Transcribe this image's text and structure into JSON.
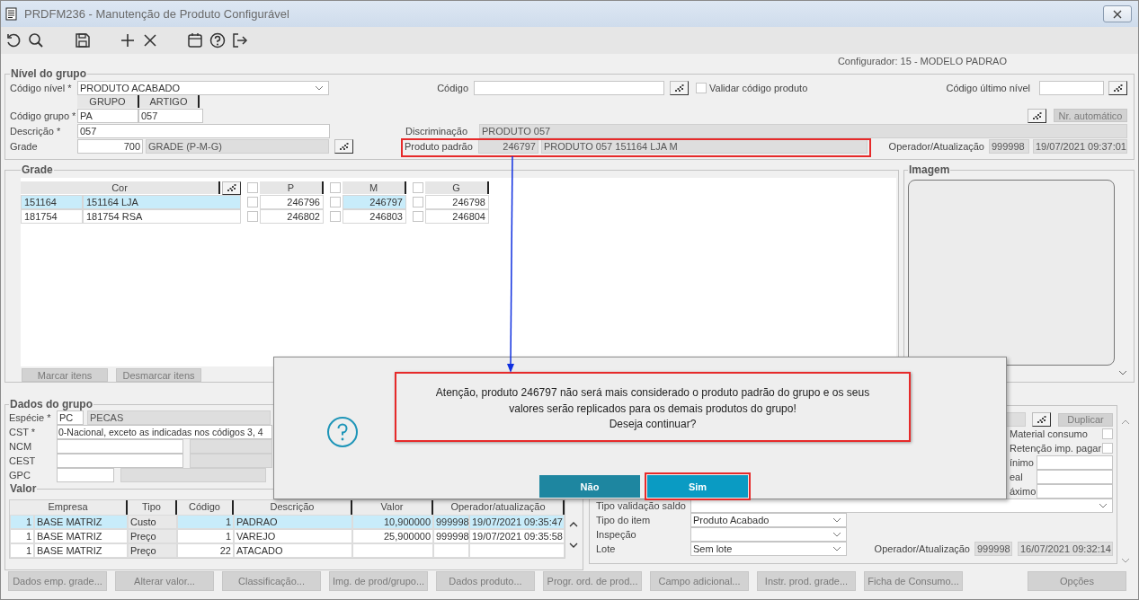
{
  "window": {
    "title": "PRDFM236 - Manutenção de Produto Configurável"
  },
  "configurador": "Configurador: 15 - MODELO PADRAO",
  "nivel_do_grupo": {
    "legend": "Nível do grupo",
    "codigo_nivel": {
      "label": "Código nível *",
      "value": "PRODUTO ACABADO"
    },
    "codigo": {
      "label": "Código"
    },
    "validar": {
      "label": "Validar código produto",
      "checked": false
    },
    "codigo_ultimo_nivel": {
      "label": "Código último nível"
    },
    "grupo_header": "GRUPO",
    "artigo_header": "ARTIGO",
    "codigo_grupo": {
      "label": "Código grupo *",
      "grupo": "PA",
      "artigo": "057"
    },
    "nr_automatico": "Nr. automático",
    "descricao": {
      "label": "Descrição *",
      "value": "057"
    },
    "discriminacao": {
      "label": "Discriminação",
      "value": "PRODUTO 057"
    },
    "grade": {
      "label": "Grade",
      "code": "700",
      "name": "GRADE (P-M-G)"
    },
    "produto_padrao": {
      "label": "Produto padrão",
      "code": "246797",
      "name": "PRODUTO 057 151164 LJA M"
    },
    "operador": {
      "label": "Operador/Atualização",
      "op": "999998",
      "date": "19/07/2021 09:37:01"
    }
  },
  "grade": {
    "legend": "Grade",
    "cor_header": "Cor",
    "sizes": [
      {
        "label": "P",
        "checked": false
      },
      {
        "label": "M",
        "checked": false
      },
      {
        "label": "G",
        "checked": false
      }
    ],
    "rows": [
      {
        "code": "151164",
        "name": "151164 LJA",
        "selected": true,
        "cells": [
          {
            "value": "246796",
            "checked": false,
            "selected": false
          },
          {
            "value": "246797",
            "checked": false,
            "selected": true
          },
          {
            "value": "246798",
            "checked": false,
            "selected": false
          }
        ]
      },
      {
        "code": "181754",
        "name": "181754 RSA",
        "selected": false,
        "cells": [
          {
            "value": "246802",
            "checked": false,
            "selected": false
          },
          {
            "value": "246803",
            "checked": false,
            "selected": false
          },
          {
            "value": "246804",
            "checked": false,
            "selected": false
          }
        ]
      }
    ],
    "buttons": [
      "Marcar itens",
      "Desmarcar itens"
    ]
  },
  "imagem": {
    "legend": "Imagem"
  },
  "dados_do_grupo": {
    "legend": "Dados do grupo",
    "especie": {
      "label": "Espécie *",
      "code": "PC",
      "name": "PECAS"
    },
    "cst": {
      "label": "CST *",
      "value": "0-Nacional, exceto as indicadas nos códigos 3, 4"
    },
    "ncm": {
      "label": "NCM"
    },
    "cest": {
      "label": "CEST"
    },
    "gpc": {
      "label": "GPC"
    },
    "duplicar": "Duplicar",
    "flags": [
      {
        "label": "Material consumo",
        "checked": false
      },
      {
        "label": "Retenção imp. pagar",
        "checked": false
      }
    ],
    "limits": [
      {
        "label": "ínimo"
      },
      {
        "label": "eal"
      },
      {
        "label": "áximo"
      }
    ],
    "tipo_validacao_saldo": {
      "label": "Tipo validação saldo"
    },
    "tipo_do_item": {
      "label": "Tipo do item",
      "value": "Produto Acabado"
    },
    "inspecao": {
      "label": "Inspeção"
    },
    "lote": {
      "label": "Lote",
      "value": "Sem lote"
    },
    "operador": {
      "label": "Operador/Atualização",
      "op": "999998",
      "date": "16/07/2021 09:32:14"
    }
  },
  "valor": {
    "legend": "Valor",
    "columns": [
      "Empresa",
      "Tipo",
      "Código",
      "Descrição",
      "Valor",
      "Operador/atualização"
    ],
    "rows": [
      {
        "empresa": "1",
        "nome": "BASE MATRIZ",
        "tipo": "Custo",
        "codigo": "1",
        "descricao": "PADRAO",
        "valor": "10,900000",
        "operador": "999998",
        "data": "19/07/2021 09:35:47",
        "selected": true
      },
      {
        "empresa": "1",
        "nome": "BASE MATRIZ",
        "tipo": "Preço",
        "codigo": "1",
        "descricao": "VAREJO",
        "valor": "25,900000",
        "operador": "999998",
        "data": "19/07/2021 09:35:58",
        "selected": false
      },
      {
        "empresa": "1",
        "nome": "BASE MATRIZ",
        "tipo": "Preço",
        "codigo": "22",
        "descricao": "ATACADO",
        "selected": false
      }
    ]
  },
  "bottom_buttons": [
    "Dados emp. grade...",
    "Alterar valor...",
    "Classificação...",
    "Img. de prod/grupo...",
    "Dados produto...",
    "Progr. ord. de prod...",
    "Campo adicional...",
    "Instr. prod. grade...",
    "Ficha de Consumo...",
    "Opções"
  ],
  "dialog": {
    "message": "Atenção, produto 246797 não será mais considerado o produto padrão do grupo e os seus\nvalores serão replicados para os demais produtos do grupo!\nDeseja continuar?",
    "buttons": [
      {
        "label": "Não",
        "focused": false
      },
      {
        "label": "Sim",
        "focused": true
      }
    ]
  }
}
